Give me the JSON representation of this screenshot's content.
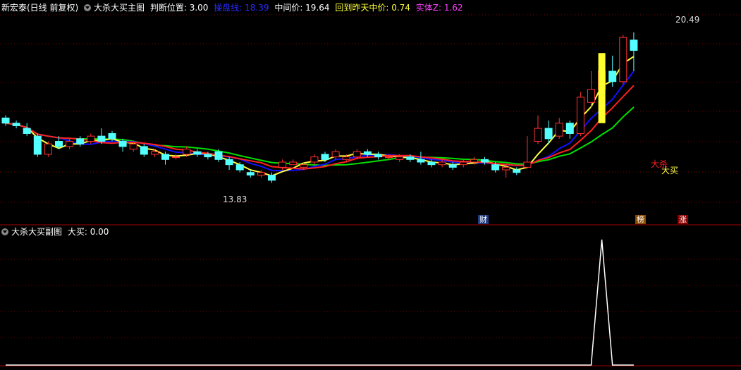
{
  "main_header": {
    "stock": "新宏泰(日线 前复权)",
    "indicator": "大杀大买主图",
    "judge": "判断位置: 3.00",
    "line_label": "操盘线: 18.39",
    "mid_price": "中间价: 19.64",
    "back_mid": "回到昨天中价: 0.74",
    "entity": "实体Z: 1.62"
  },
  "sub_header": {
    "indicator": "大杀大买副图",
    "value": "大买: 0.00"
  },
  "annotations": {
    "high": "20.49",
    "low": "13.83",
    "sell": "大杀",
    "buy": "大买"
  },
  "badges": {
    "cai": "财",
    "bang": "榜",
    "zhang": "涨"
  },
  "colors": {
    "up": "#ff3232",
    "down": "#54ffff",
    "green_line": "#00e000",
    "blue_line": "#1010ff",
    "yellow_line": "#ffff40",
    "red_line": "#ff2020",
    "grid": "#7a0000"
  },
  "chart_data": [
    {
      "type": "candlestick",
      "title": "大杀大买主图",
      "y_high": 20.49,
      "y_low": 13.83,
      "candles": [
        [
          0,
          17.2,
          17.0,
          17.3,
          16.9
        ],
        [
          1,
          17.0,
          16.9,
          17.1,
          16.8
        ],
        [
          2,
          16.8,
          16.6,
          17.0,
          16.5
        ],
        [
          3,
          16.5,
          15.8,
          16.6,
          15.7
        ],
        [
          4,
          15.8,
          16.2,
          16.3,
          15.7
        ],
        [
          5,
          16.3,
          16.1,
          16.5,
          16.0
        ],
        [
          6,
          16.1,
          16.3,
          16.4,
          16.0
        ],
        [
          7,
          16.4,
          16.2,
          16.5,
          16.1
        ],
        [
          8,
          16.3,
          16.5,
          16.6,
          16.2
        ],
        [
          9,
          16.5,
          16.3,
          16.8,
          16.2
        ],
        [
          10,
          16.6,
          16.4,
          16.7,
          16.3
        ],
        [
          11,
          16.3,
          16.1,
          16.4,
          15.9
        ],
        [
          12,
          16.0,
          16.2,
          16.3,
          15.9
        ],
        [
          13,
          16.1,
          15.8,
          16.2,
          15.7
        ],
        [
          14,
          15.8,
          15.9,
          16.0,
          15.7
        ],
        [
          15,
          15.8,
          15.6,
          15.9,
          15.4
        ],
        [
          16,
          15.7,
          15.7,
          15.8,
          15.6
        ],
        [
          17,
          15.8,
          16.0,
          16.1,
          15.7
        ],
        [
          18,
          15.9,
          15.8,
          16.0,
          15.7
        ],
        [
          19,
          15.8,
          15.7,
          15.9,
          15.6
        ],
        [
          20,
          15.9,
          15.6,
          16.0,
          15.5
        ],
        [
          21,
          15.6,
          15.4,
          15.7,
          15.2
        ],
        [
          22,
          15.4,
          15.2,
          15.5,
          15.1
        ],
        [
          23,
          15.1,
          15.0,
          15.2,
          14.9
        ],
        [
          24,
          15.0,
          15.1,
          15.2,
          14.9
        ],
        [
          25,
          15.0,
          14.8,
          15.1,
          14.7
        ],
        [
          26,
          15.3,
          15.5,
          15.6,
          15.2
        ],
        [
          27,
          15.4,
          15.5,
          15.6,
          15.4
        ],
        [
          28,
          15.3,
          15.4,
          15.5,
          15.2
        ],
        [
          29,
          15.5,
          15.7,
          15.8,
          15.4
        ],
        [
          30,
          15.8,
          15.6,
          15.9,
          15.5
        ],
        [
          31,
          15.7,
          15.9,
          16.0,
          15.6
        ],
        [
          32,
          15.6,
          15.7,
          15.8,
          15.5
        ],
        [
          33,
          15.7,
          15.9,
          16.0,
          15.6
        ],
        [
          34,
          15.9,
          15.8,
          16.0,
          15.7
        ],
        [
          35,
          15.8,
          15.7,
          15.9,
          15.6
        ],
        [
          36,
          15.7,
          15.7,
          15.8,
          15.6
        ],
        [
          37,
          15.6,
          15.7,
          15.8,
          15.5
        ],
        [
          38,
          15.7,
          15.6,
          15.8,
          15.5
        ],
        [
          39,
          15.6,
          15.5,
          15.9,
          15.4
        ],
        [
          40,
          15.5,
          15.4,
          15.6,
          15.3
        ],
        [
          41,
          15.4,
          15.5,
          15.6,
          15.3
        ],
        [
          42,
          15.4,
          15.3,
          15.5,
          15.2
        ],
        [
          43,
          15.4,
          15.5,
          15.6,
          15.3
        ],
        [
          44,
          15.5,
          15.6,
          15.7,
          15.4
        ],
        [
          45,
          15.6,
          15.5,
          15.7,
          15.4
        ],
        [
          46,
          15.4,
          15.2,
          15.5,
          15.1
        ],
        [
          47,
          15.2,
          15.3,
          15.4,
          14.9
        ],
        [
          48,
          15.2,
          15.1,
          15.3,
          15.0
        ],
        [
          49,
          15.3,
          15.5,
          16.5,
          15.3
        ],
        [
          50,
          16.3,
          16.8,
          17.3,
          16.2
        ],
        [
          51,
          16.8,
          16.4,
          17.1,
          16.2
        ],
        [
          52,
          16.5,
          17.0,
          17.2,
          16.4
        ],
        [
          53,
          17.0,
          16.6,
          17.1,
          16.4
        ],
        [
          54,
          16.6,
          18.0,
          18.2,
          16.5
        ],
        [
          55,
          17.8,
          18.3,
          19.0,
          17.6
        ],
        [
          56,
          18.3,
          19.0,
          19.5,
          18.1
        ],
        [
          57,
          19.0,
          18.6,
          19.6,
          18.4
        ],
        [
          58,
          18.6,
          20.3,
          20.4,
          18.5
        ],
        [
          59,
          20.2,
          19.8,
          20.5,
          19.0
        ]
      ]
    },
    {
      "type": "line",
      "title": "大杀大买副图",
      "series": [
        {
          "name": "大买",
          "values": [
            0,
            0,
            0,
            0,
            0,
            0,
            0,
            0,
            0,
            0,
            0,
            0,
            0,
            0,
            0,
            0,
            0,
            0,
            0,
            0,
            0,
            0,
            0,
            0,
            0,
            0,
            0,
            0,
            0,
            0,
            0,
            0,
            0,
            0,
            0,
            0,
            0,
            0,
            0,
            0,
            0,
            0,
            0,
            0,
            0,
            0,
            0,
            0,
            0,
            0,
            0,
            0,
            0,
            0,
            0,
            0,
            1,
            0,
            0,
            0
          ]
        }
      ]
    }
  ]
}
